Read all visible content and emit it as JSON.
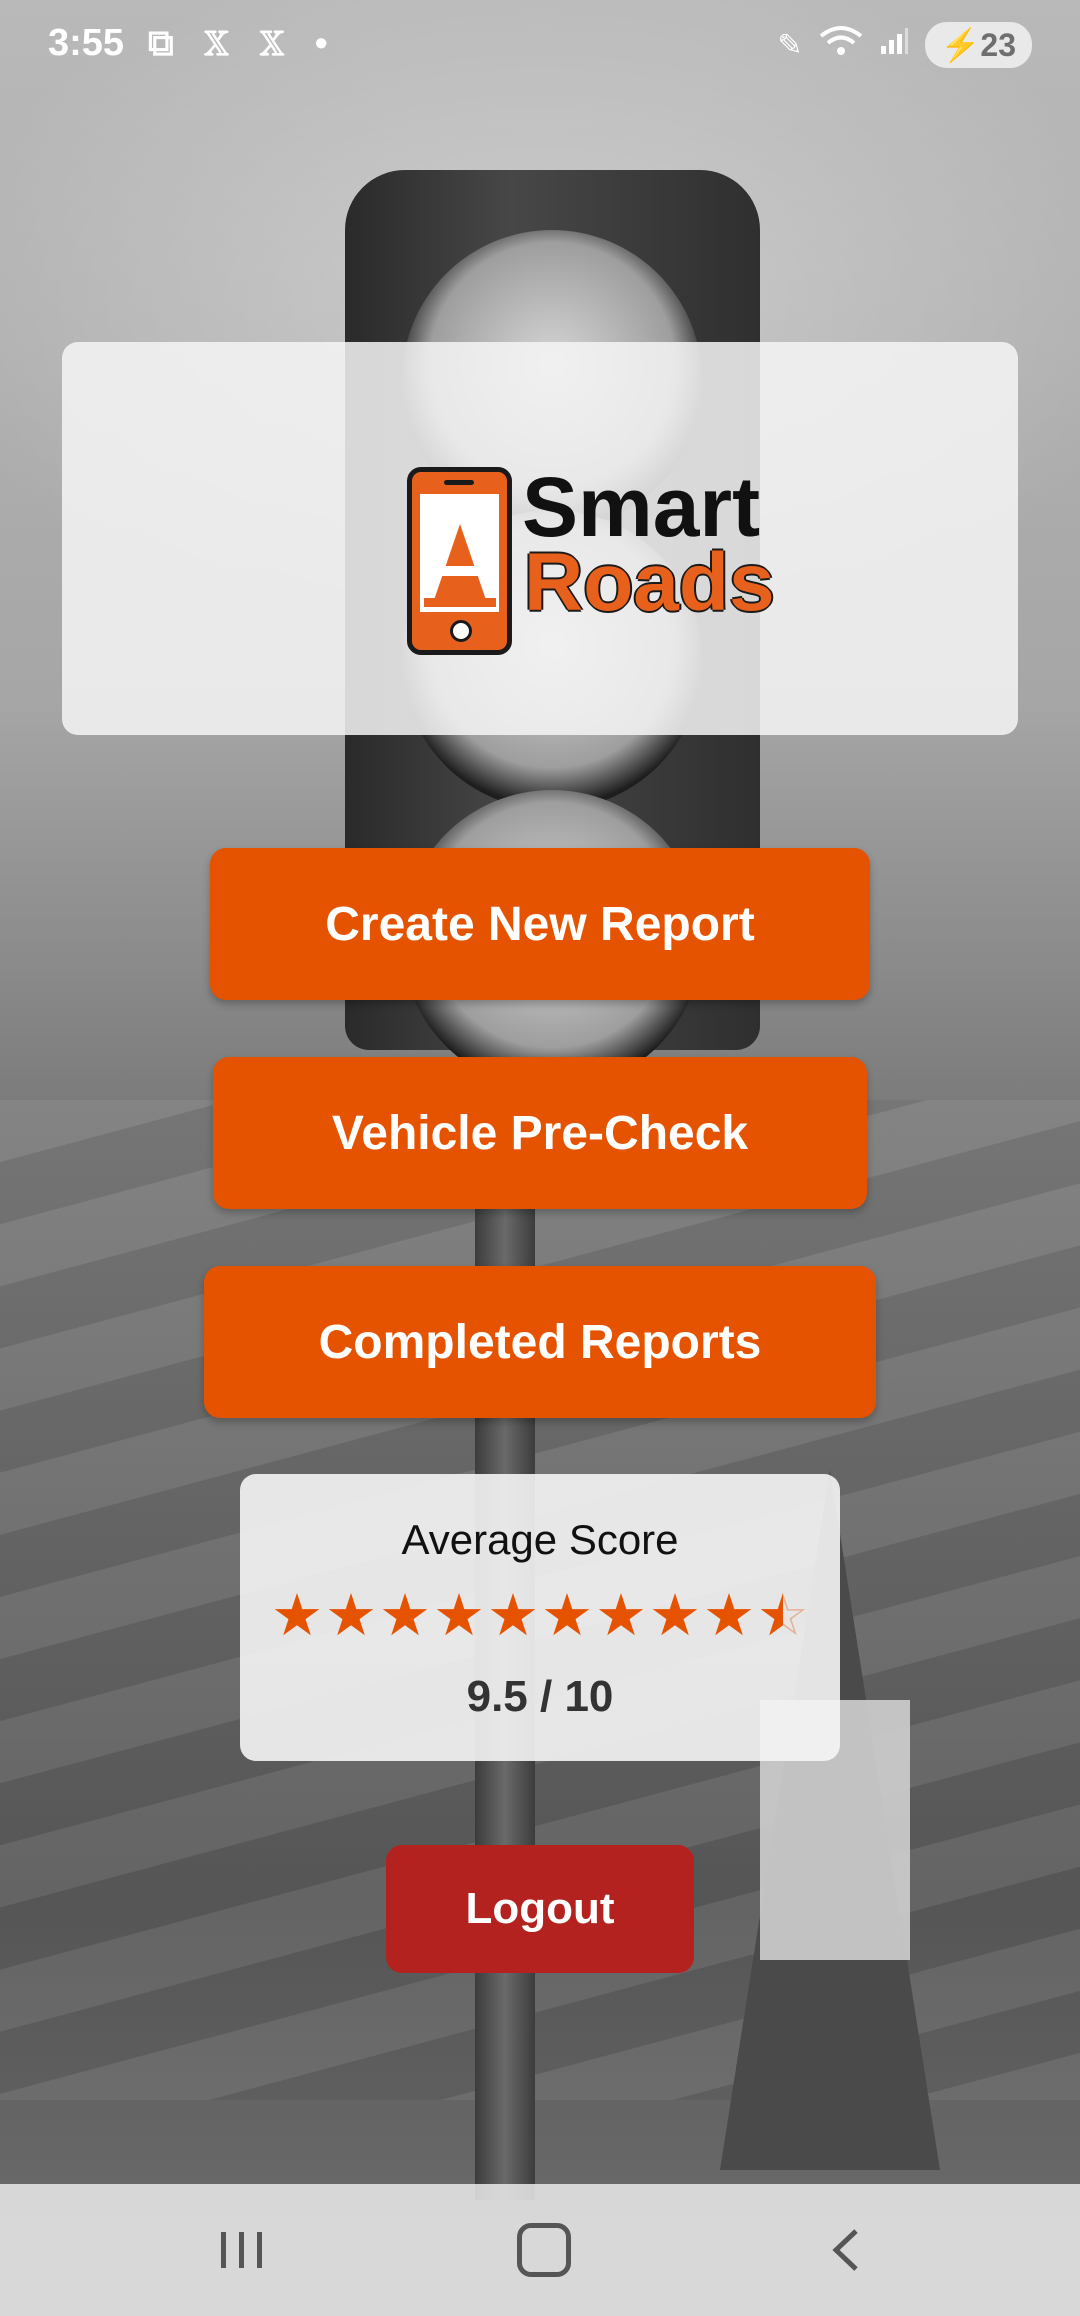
{
  "status_bar": {
    "time": "3:55",
    "left_icons": "⧉ 𝕏 𝕏 •",
    "battery": "23"
  },
  "logo": {
    "line1": "Smart",
    "line2": "Roads",
    "colors": {
      "accent": "#e8611c",
      "dark": "#111111"
    }
  },
  "menu": {
    "create_label": "Create New Report",
    "precheck_label": "Vehicle Pre-Check",
    "completed_label": "Completed Reports"
  },
  "score": {
    "title": "Average Score",
    "rating": 9.5,
    "max": 10,
    "display": "9.5 / 10"
  },
  "logout_label": "Logout",
  "nav": {
    "recent_icon": "recent-apps-icon",
    "home_icon": "home-icon",
    "back_icon": "back-icon"
  },
  "colors": {
    "button": "#e55300",
    "logout": "#b3221f"
  }
}
